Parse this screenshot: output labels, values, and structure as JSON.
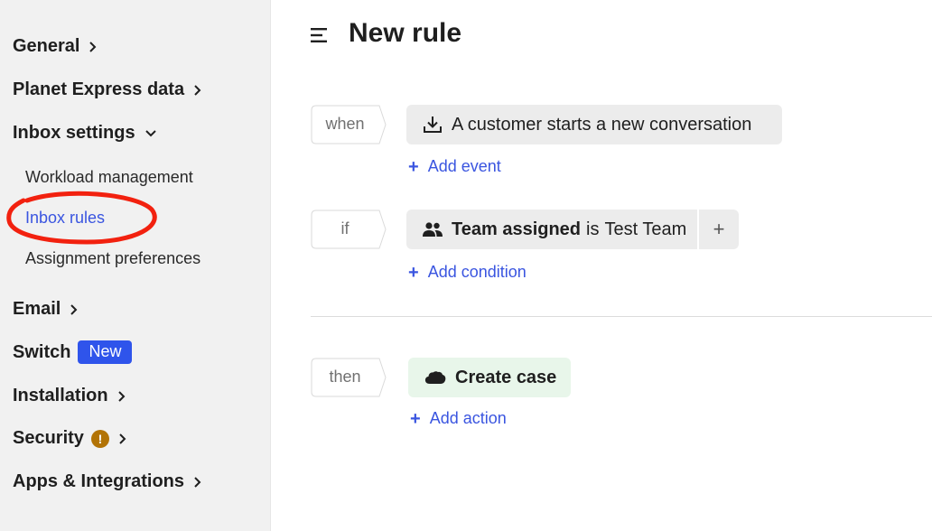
{
  "sidebar": {
    "general": "General",
    "planet_express": "Planet Express data",
    "inbox_settings": "Inbox settings",
    "sub_items": [
      "Workload management",
      "Inbox rules",
      "Assignment preferences"
    ],
    "email": "Email",
    "switch": "Switch",
    "switch_badge": "New",
    "installation": "Installation",
    "security": "Security",
    "security_alert": "!",
    "apps": "Apps & Integrations"
  },
  "header": {
    "title": "New rule"
  },
  "rule": {
    "when": {
      "label": "when",
      "event": "A customer starts a new conversation",
      "add": "Add event"
    },
    "if": {
      "label": "if",
      "attr": "Team assigned",
      "op": "is",
      "value": "Test Team",
      "extra": "+",
      "add": "Add condition"
    },
    "then": {
      "label": "then",
      "action": "Create case",
      "add": "Add action"
    }
  },
  "colors": {
    "accent": "#3a55e0",
    "badge": "#2f54eb",
    "warning": "#b27305",
    "annotation": "#f2210f"
  }
}
